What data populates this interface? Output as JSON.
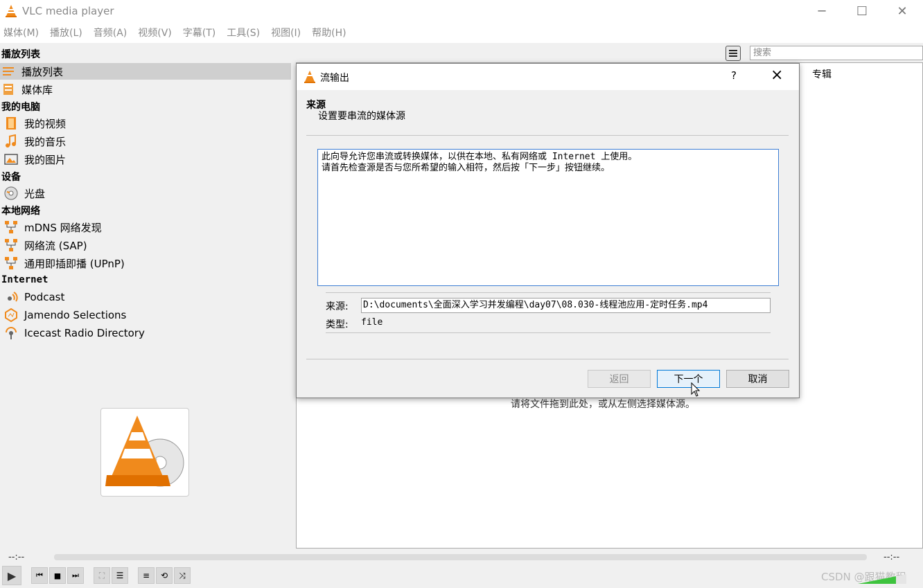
{
  "window": {
    "title": "VLC media player"
  },
  "menu": [
    "媒体(M)",
    "播放(L)",
    "音频(A)",
    "视频(V)",
    "字幕(T)",
    "工具(S)",
    "视图(I)",
    "帮助(H)"
  ],
  "sidebar": {
    "header": "播放列表",
    "items_top": [
      {
        "label": "播放列表",
        "icon": "playlist-icon",
        "selected": true
      },
      {
        "label": "媒体库",
        "icon": "library-icon"
      }
    ],
    "my_computer": {
      "title": "我的电脑",
      "items": [
        {
          "label": "我的视频",
          "icon": "film-icon"
        },
        {
          "label": "我的音乐",
          "icon": "music-note-icon"
        },
        {
          "label": "我的图片",
          "icon": "picture-icon"
        }
      ]
    },
    "devices": {
      "title": "设备",
      "items": [
        {
          "label": "光盘",
          "icon": "disc-icon"
        }
      ]
    },
    "local_network": {
      "title": "本地网络",
      "items": [
        {
          "label": "mDNS 网络发现",
          "icon": "network-icon"
        },
        {
          "label": "网络流 (SAP)",
          "icon": "network-icon"
        },
        {
          "label": "通用即插即播 (UPnP)",
          "icon": "network-icon"
        }
      ]
    },
    "internet": {
      "title": "Internet",
      "items": [
        {
          "label": "Podcast",
          "icon": "podcast-icon"
        },
        {
          "label": "Jamendo Selections",
          "icon": "jamendo-icon"
        },
        {
          "label": "Icecast Radio Directory",
          "icon": "icecast-icon"
        }
      ]
    }
  },
  "playlist": {
    "search_placeholder": "搜索",
    "column": "专辑",
    "empty_hint": "请将文件拖到此处，或从左侧选择媒体源。"
  },
  "player": {
    "time_elapsed": "--:--",
    "time_total": "--:--",
    "watermark": "CSDN @跟猫教程"
  },
  "dialog": {
    "title": "流输出",
    "help": "?",
    "section_title": "来源",
    "section_subtitle": "设置要串流的媒体源",
    "info_line1": "此向导允许您串流或转换媒体，以供在本地、私有网络或 Internet 上使用。",
    "info_line2": "请首先检查源是否与您所希望的输入相符，然后按「下一步」按钮继续。",
    "source_label": "来源:",
    "source_value": "D:\\documents\\全面深入学习并发编程\\day07\\08.030-线程池应用-定时任务.mp4",
    "type_label": "类型:",
    "type_value": "file",
    "btn_back": "返回",
    "btn_next": "下一个",
    "btn_cancel": "取消"
  },
  "colors": {
    "vlc_orange": "#f08a1c",
    "accent_blue": "#0078d7"
  }
}
